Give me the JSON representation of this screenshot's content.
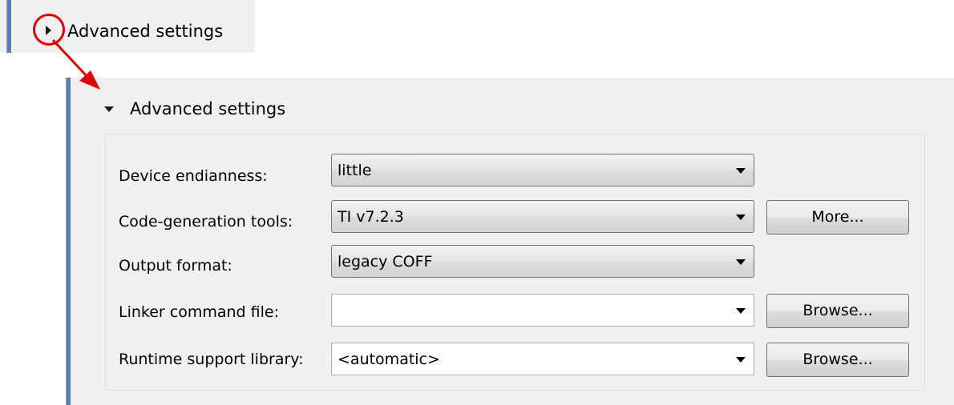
{
  "collapsed": {
    "label": "Advanced settings"
  },
  "expanded": {
    "label": "Advanced settings"
  },
  "settings": {
    "rows": [
      {
        "label": "Device endianness:",
        "value": "little"
      },
      {
        "label": "Code-generation tools:",
        "value": "TI v7.2.3",
        "button": "More..."
      },
      {
        "label": "Output format:",
        "value": "legacy COFF"
      },
      {
        "label": "Linker command file:",
        "value": "",
        "button": "Browse..."
      },
      {
        "label": "Runtime support library:",
        "value": "<automatic>",
        "button": "Browse..."
      }
    ]
  },
  "colors": {
    "annotation": "#e00000",
    "section_border": "#5c7fb3"
  }
}
